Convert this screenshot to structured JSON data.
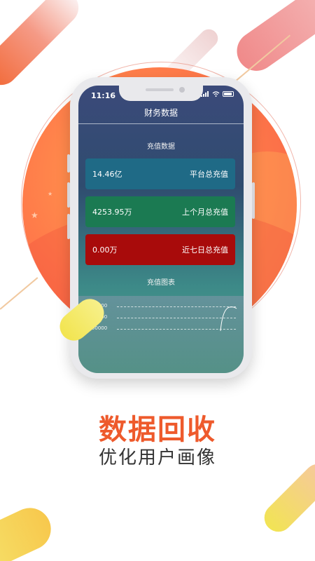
{
  "status_bar": {
    "time": "11:16"
  },
  "nav": {
    "title": "财务数据"
  },
  "recharge": {
    "section_title": "充值数据",
    "cards": [
      {
        "value": "14.46亿",
        "label": "平台总充值",
        "color": "#1f6a86"
      },
      {
        "value": "4253.95万",
        "label": "上个月总充值",
        "color": "#1b7a52"
      },
      {
        "value": "0.00万",
        "label": "近七日总充值",
        "color": "#a80b0b"
      }
    ]
  },
  "chart": {
    "section_title": "充值图表",
    "ticks": [
      "4000000",
      "3500000",
      "3000000"
    ]
  },
  "promo": {
    "headline": "数据回收",
    "subline": "优化用户画像"
  },
  "colors": {
    "accent": "#ee5a2c"
  },
  "icons": [
    "signal-icon",
    "wifi-icon",
    "battery-icon",
    "star-icon"
  ]
}
